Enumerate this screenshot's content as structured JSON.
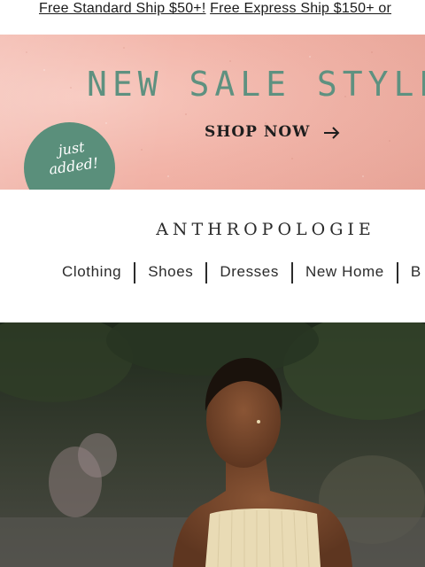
{
  "promo_bar": {
    "link_standard": "Free Standard Ship $50+!",
    "link_express": "Free Express Ship $150+ or"
  },
  "hero": {
    "title": "NEW SALE STYLE",
    "cta": "SHOP NOW",
    "badge_line1": "just",
    "badge_line2": "added!",
    "colors": {
      "background": "#f2b4a8",
      "title": "#5e9180",
      "badge": "#5a8f7b"
    }
  },
  "brand": {
    "name": "ANTHROPOLOGIE"
  },
  "nav": {
    "items": [
      "Clothing",
      "Shoes",
      "Dresses",
      "New Home",
      "B"
    ]
  },
  "feature_image": {
    "icon": "model-photo"
  }
}
